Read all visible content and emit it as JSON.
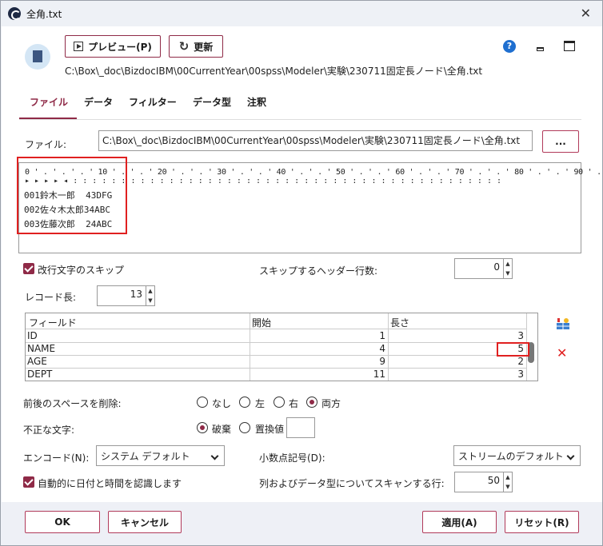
{
  "window": {
    "title": "全角.txt",
    "close_glyph": "✕"
  },
  "toolbar": {
    "preview_label": "プレビュー(P)",
    "refresh_label": "更新"
  },
  "path": "C:\\Box\\_doc\\BizdocIBM\\00CurrentYear\\00spss\\Modeler\\実験\\230711固定長ノード\\全角.txt",
  "tabs": [
    "ファイル",
    "データ",
    "フィルター",
    "データ型",
    "注釈"
  ],
  "file": {
    "label": "ファイル:",
    "value": "C:\\Box\\_doc\\BizdocIBM\\00CurrentYear\\00spss\\Modeler\\実験\\230711固定長ノード\\全角.txt",
    "browse_label": "..."
  },
  "preview": {
    "ruler": "0 ' . ' . ' . ' 10 ' . ' . ' 20 ' . ' . ' 30 ' . ' . ' 40 ' . ' . ' 50 ' . ' . ' 60 ' . ' . ' 70 ' . ' . ' 80 ' . ' . ' 90 ' . ' .",
    "lines": [
      "001鈴木一郎  43DFG",
      "002佐々木太郎34ABC",
      "003佐藤次郎  24ABC"
    ]
  },
  "options": {
    "skip_newline_label": "改行文字のスキップ",
    "skip_header_label": "スキップするヘッダー行数:",
    "skip_header_value": "0",
    "record_length_label": "レコード長:",
    "record_length_value": "13"
  },
  "table": {
    "headers": [
      "フィールド",
      "開始",
      "長さ"
    ],
    "rows": [
      {
        "field": "ID",
        "start": "1",
        "length": "3"
      },
      {
        "field": "NAME",
        "start": "4",
        "length": "5"
      },
      {
        "field": "AGE",
        "start": "9",
        "length": "2"
      },
      {
        "field": "DEPT",
        "start": "11",
        "length": "3"
      }
    ]
  },
  "trim": {
    "label": "前後のスペースを削除:",
    "options": [
      "なし",
      "左",
      "右",
      "両方"
    ],
    "selected": "両方"
  },
  "invalid": {
    "label": "不正な文字:",
    "options": [
      "破棄",
      "置換値"
    ],
    "selected": "破棄",
    "replace_value": ""
  },
  "encoding": {
    "label": "エンコード(N):",
    "value": "システム デフォルト"
  },
  "decimal": {
    "label": "小数点記号(D):",
    "value": "ストリームのデフォルト"
  },
  "autodate": {
    "label": "自動的に日付と時間を認識します"
  },
  "scan": {
    "label": "列およびデータ型についてスキャンする行:",
    "value": "50"
  },
  "buttons": {
    "ok": "OK",
    "cancel": "キャンセル",
    "apply": "適用(A)",
    "reset": "リセット(R)"
  },
  "colors": {
    "accent": "#8f2a47",
    "highlight": "#e02020"
  }
}
